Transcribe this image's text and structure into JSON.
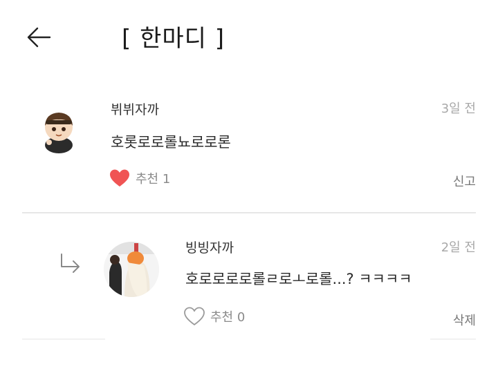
{
  "header": {
    "title": "[ 한마디 ]",
    "back_icon": "arrow-left-icon"
  },
  "comments": [
    {
      "author": "뷔뷔자까",
      "time": "3일 전",
      "text": "호롯로로롤뇨로로론",
      "like_label": "추천 1",
      "liked": true,
      "action": "신고",
      "avatar": "chibi-avatar"
    }
  ],
  "replies": [
    {
      "reply_icon": "reply-arrow-icon",
      "author": "빙빙자까",
      "time": "2일 전",
      "text": "호로로로로롤ㄹ로ㅗ로롤...? ㅋㅋㅋㅋ",
      "like_label": "추천 0",
      "liked": false,
      "action": "삭제",
      "avatar": "photo-avatar"
    }
  ],
  "colors": {
    "heart_filled": "#f05454",
    "heart_outline": "#9a9a9a",
    "divider": "#e6e6e6",
    "muted_text": "#a8a8a8"
  }
}
